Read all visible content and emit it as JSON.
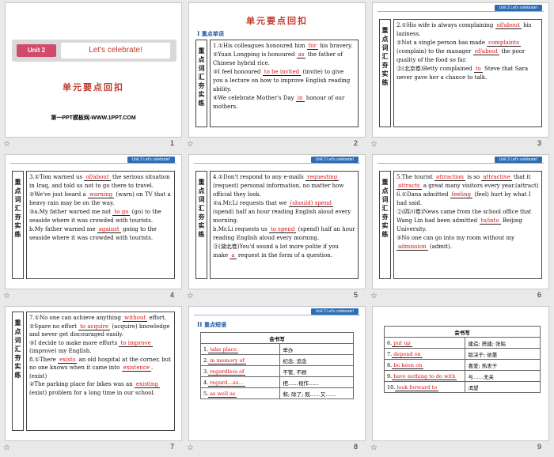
{
  "header_tab": "Unit 2   Let's celebrate!",
  "slides": {
    "s1": {
      "unit_badge": "Unit 2",
      "unit_title": "Let's celebrate!",
      "title": "单元要点回扣",
      "footer": "第一PPT模板网-WWW.1PPT.COM",
      "num": "1"
    },
    "s2": {
      "title": "单元要点回扣",
      "section": "I  重点单词",
      "label": "重点词汇夯实练",
      "lines": [
        [
          "1.①His colleagues honoured him ",
          "for",
          " his bravery."
        ],
        [
          "②Yuan Longping is honoured ",
          "as",
          " the father of Chinese hybrid rice."
        ],
        [
          "③I feel honoured ",
          "to be invited",
          " (invite) to give you a lecture on how to improve English reading ability."
        ],
        [
          "④We celebrate Mother's Day ",
          "in",
          " honour of our mothers."
        ]
      ],
      "num": "2"
    },
    "s3": {
      "label": "重点词汇夯实练",
      "lines": [
        [
          "2.①His wife is always complaining ",
          "of/about",
          " his laziness."
        ],
        [
          "②Not a single person has made ",
          "complaints",
          " (complain) to the manager ",
          "of/about",
          " the poor quality of the food so far."
        ],
        [
          "③(北京卷)Betty complained ",
          "to",
          " Steve that Sara never gave her a chance to talk."
        ]
      ],
      "num": "3"
    },
    "s4": {
      "label": "重点词汇夯实练",
      "lines": [
        [
          "3.①Tom warned us ",
          "of/about",
          " the serious situation in Iraq, and told us not to go there to travel."
        ],
        [
          "②We've just heard a ",
          "warning",
          " (warn) on TV that a heavy rain may be on the way."
        ],
        [
          "③a.My father warned me not ",
          "to go",
          " (go) to the seaside where it was crowded with tourists."
        ],
        [
          "b.My father warned me ",
          "against",
          " going to the seaside where it was crowded with tourists."
        ]
      ],
      "num": "4"
    },
    "s5": {
      "label": "重点词汇夯实练",
      "lines": [
        [
          "4.①Don't respond to any e-mails ",
          "requesting",
          " (request) personal information, no matter how official they look."
        ],
        [
          "②a.Mr.Li requests that we ",
          "(should) spend",
          " (spend) half an hour reading English aloud every morning."
        ],
        [
          "b.Mr.Li requests us ",
          "to spend",
          " (spend) half an hour reading English aloud every morning."
        ],
        [
          "③(湖北卷)You'd sound a lot more polite if you make ",
          "a",
          " request in the form of a question."
        ]
      ],
      "num": "5"
    },
    "s6": {
      "label": "重点词汇夯实练",
      "lines": [
        [
          "5.The tourist ",
          "attraction",
          " is so ",
          "attractive",
          " that it ",
          "attracts",
          " a great many visitors every year.(attract)"
        ],
        [
          "6.①Dana admitted ",
          "feeling",
          " (feel) hurt by what I had said."
        ],
        [
          "②(四川卷)News came from the school office that Wang Lin had been admitted ",
          "to/into",
          " Beijing University."
        ],
        [
          "③No one can go into my room without my ",
          "admission",
          " (admit)."
        ]
      ],
      "num": "6"
    },
    "s7": {
      "label": "重点词汇夯实练",
      "lines": [
        [
          "7.①No one can achieve anything ",
          "without",
          " effort."
        ],
        [
          "②Spare no effort ",
          "to acquire",
          " (acquire) knowledge and never get discouraged easily."
        ],
        [
          "③I decide to make more efforts ",
          "to improve",
          " (improve) my English."
        ],
        [
          "8.①There ",
          "exists",
          " an old hospital at the corner, but no one knows when it came into ",
          "existence",
          ". (exist)"
        ],
        [
          "②The parking place for bikes was an ",
          "existing",
          " (exist) problem for a long time in our school."
        ]
      ],
      "num": "7"
    },
    "s8": {
      "section": "II  重点短语",
      "table_header": "会书写",
      "rows": [
        [
          "1.",
          "take place",
          "举办"
        ],
        [
          "2.",
          "in memory of",
          "纪念; 追念"
        ],
        [
          "3.",
          "regardless of",
          "不管, 不顾"
        ],
        [
          "4.",
          "regard…as…",
          "把……视作……"
        ],
        [
          "5.",
          "as well as",
          "和; 除了; 既……又……"
        ]
      ],
      "num": "8"
    },
    "s9": {
      "table_header": "会书写",
      "rows": [
        [
          "6.",
          "put up",
          "建造; 搭建; 张贴"
        ],
        [
          "7.",
          "depend on",
          "取决于; 依靠"
        ],
        [
          "8.",
          "be keen on",
          "喜爱; 热衷于"
        ],
        [
          "9.",
          "have nothing to do with",
          "与……无关"
        ],
        [
          "10.",
          "look forward to",
          "渴望"
        ]
      ],
      "num": "9"
    }
  },
  "star": "☆"
}
